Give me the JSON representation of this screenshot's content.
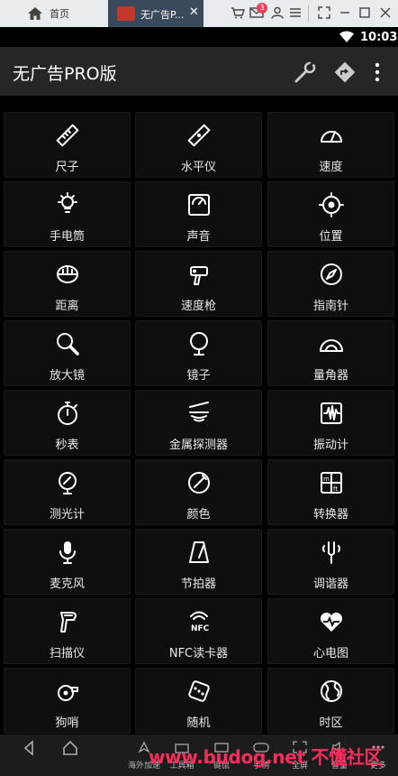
{
  "emulator": {
    "home_tab": "首页",
    "app_tab": "无广告P...",
    "badge_count": "3"
  },
  "status_bar": {
    "time": "10:03"
  },
  "app_bar": {
    "title": "无广告PRO版"
  },
  "tools": [
    {
      "label": "尺子",
      "icon": "ruler-icon"
    },
    {
      "label": "水平仪",
      "icon": "level-icon"
    },
    {
      "label": "速度",
      "icon": "speedometer-icon"
    },
    {
      "label": "手电筒",
      "icon": "flashlight-icon"
    },
    {
      "label": "声音",
      "icon": "sound-meter-icon"
    },
    {
      "label": "位置",
      "icon": "location-icon"
    },
    {
      "label": "距离",
      "icon": "tape-measure-icon"
    },
    {
      "label": "速度枪",
      "icon": "speed-gun-icon"
    },
    {
      "label": "指南针",
      "icon": "compass-icon"
    },
    {
      "label": "放大镜",
      "icon": "magnifier-icon"
    },
    {
      "label": "镜子",
      "icon": "mirror-icon"
    },
    {
      "label": "量角器",
      "icon": "protractor-icon"
    },
    {
      "label": "秒表",
      "icon": "stopwatch-icon"
    },
    {
      "label": "金属探测器",
      "icon": "metal-detector-icon"
    },
    {
      "label": "振动计",
      "icon": "vibrometer-icon"
    },
    {
      "label": "测光计",
      "icon": "light-meter-icon"
    },
    {
      "label": "颜色",
      "icon": "color-picker-icon"
    },
    {
      "label": "转换器",
      "icon": "converter-icon"
    },
    {
      "label": "麦克风",
      "icon": "microphone-icon"
    },
    {
      "label": "节拍器",
      "icon": "metronome-icon"
    },
    {
      "label": "调谐器",
      "icon": "tuner-icon"
    },
    {
      "label": "扫描仪",
      "icon": "scanner-icon"
    },
    {
      "label": "NFC读卡器",
      "icon": "nfc-icon"
    },
    {
      "label": "心电图",
      "icon": "heart-rate-icon"
    },
    {
      "label": "狗哨",
      "icon": "whistle-icon"
    },
    {
      "label": "随机",
      "icon": "dice-icon"
    },
    {
      "label": "时区",
      "icon": "globe-icon"
    }
  ],
  "bottom_bar": {
    "items": [
      "海外加速",
      "工具箱",
      "键鼠",
      "手柄",
      "全屏",
      "音量",
      "更多"
    ]
  },
  "watermark": "www.budog.net 不懂社区"
}
